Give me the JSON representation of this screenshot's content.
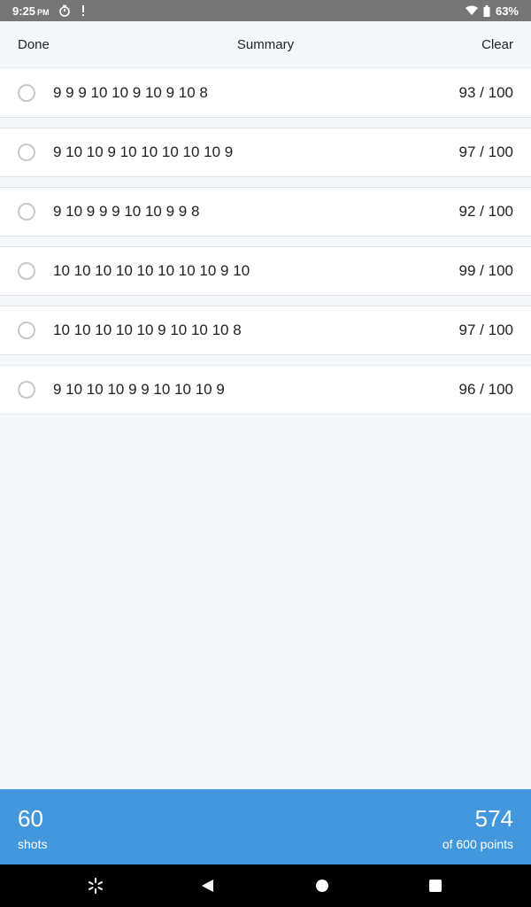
{
  "status_bar": {
    "time": "9:25",
    "ampm": "PM",
    "battery": "63%",
    "icons": [
      "stopwatch-icon",
      "alert-icon",
      "wifi-icon",
      "battery-icon"
    ]
  },
  "header": {
    "left_label": "Done",
    "title": "Summary",
    "right_label": "Clear"
  },
  "rows": [
    {
      "shots": "9 9 9 10 10 9 10 9 10 8",
      "score": "93 / 100"
    },
    {
      "shots": "9 10 10 9 10 10 10 10 10 9",
      "score": "97 / 100"
    },
    {
      "shots": "9 10 9 9 9 10 10 9 9 8",
      "score": "92 / 100"
    },
    {
      "shots": "10 10 10 10 10 10 10 10 9 10",
      "score": "99 / 100"
    },
    {
      "shots": "10 10 10 10 10 9 10 10 10 8",
      "score": "97 / 100"
    },
    {
      "shots": "9 10 10 10 9 9 10 10 10 9",
      "score": "96 / 100"
    }
  ],
  "footer": {
    "shots_value": "60",
    "shots_label": "shots",
    "points_value": "574",
    "points_label": "of 600 points"
  },
  "colors": {
    "accent": "#4398dd",
    "background": "#f5f8fb",
    "status_bar": "#767676"
  }
}
